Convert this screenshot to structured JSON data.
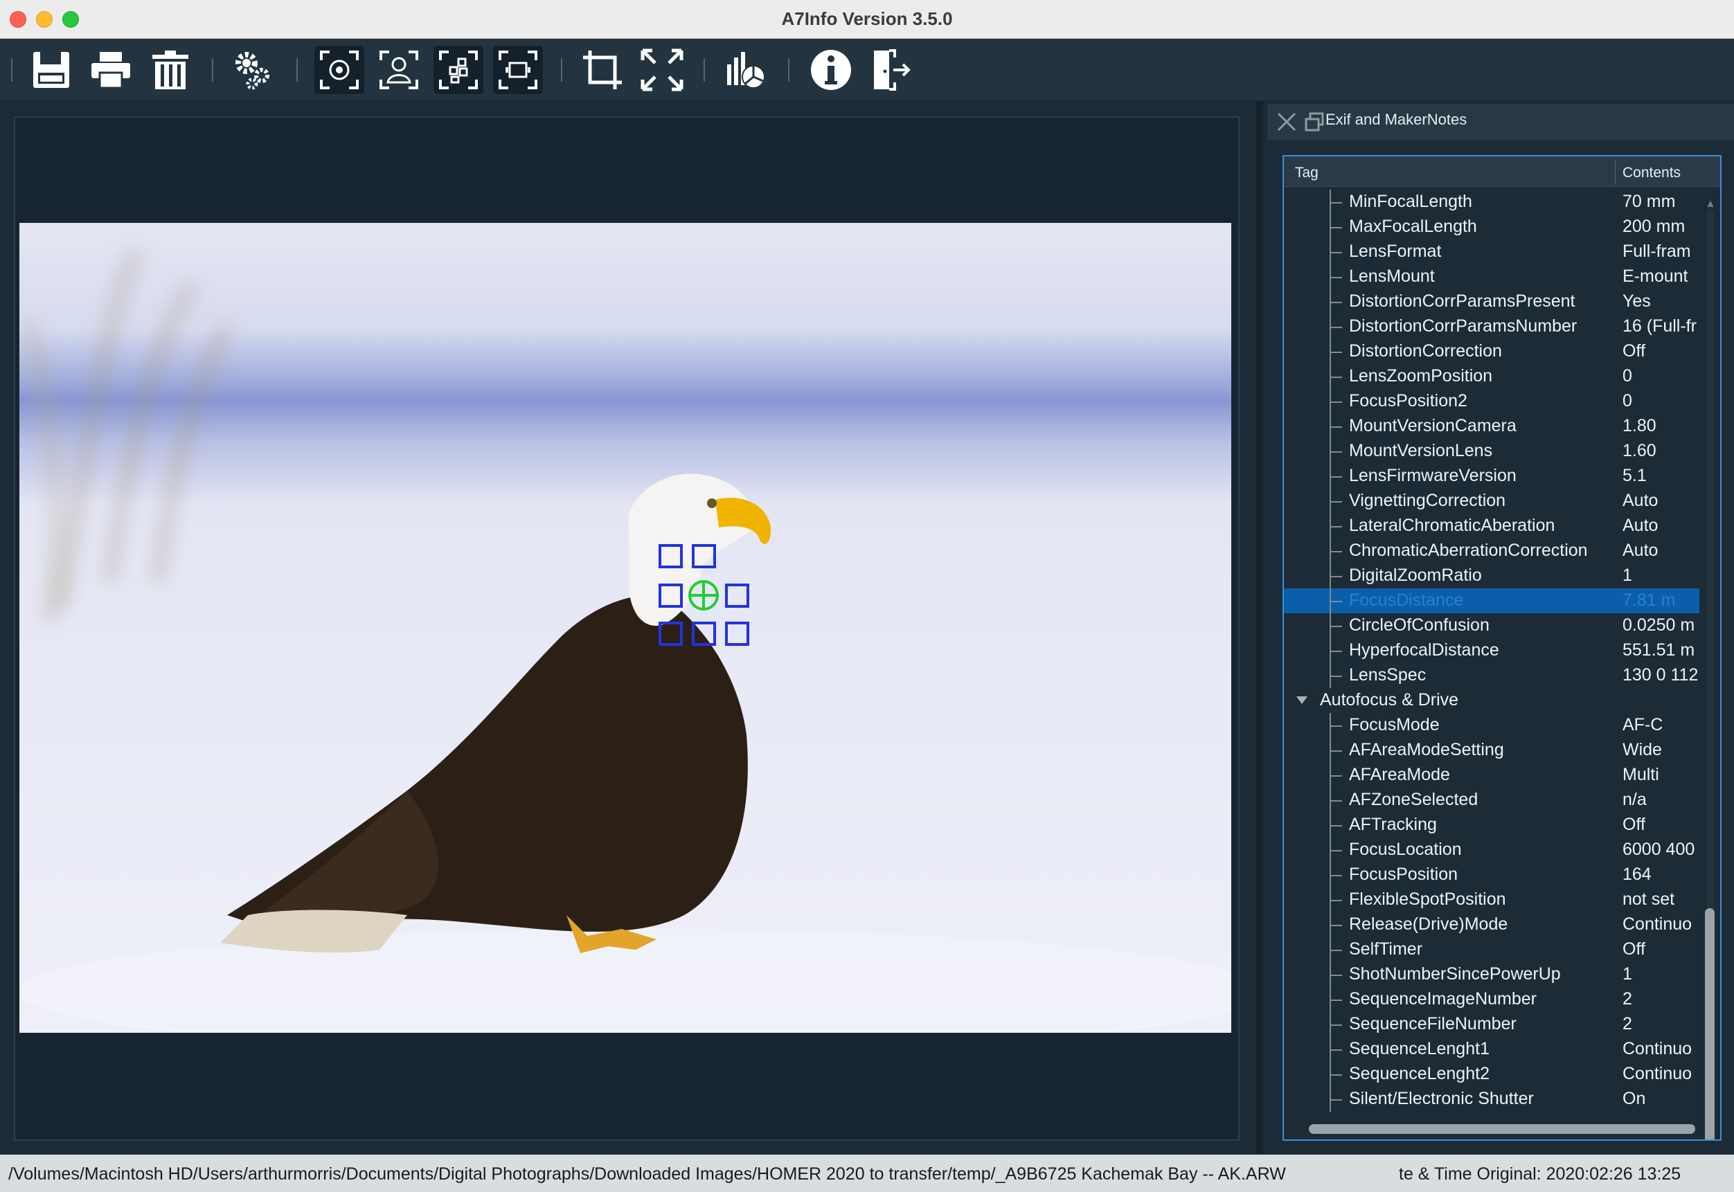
{
  "window": {
    "title": "A7Info Version 3.5.0"
  },
  "toolbar": {
    "buttons": [
      {
        "name": "save-icon",
        "label": "Save"
      },
      {
        "name": "print-icon",
        "label": "Print"
      },
      {
        "name": "trash-icon",
        "label": "Delete"
      },
      {
        "name": "settings-gears-icon",
        "label": "Settings"
      },
      {
        "name": "focus-point-icon",
        "label": "Focus point",
        "active": true
      },
      {
        "name": "face-detect-icon",
        "label": "Face detection"
      },
      {
        "name": "af-area-icon",
        "label": "AF area",
        "active": true
      },
      {
        "name": "frame-icon",
        "label": "Frame",
        "active": true
      },
      {
        "name": "crop-icon",
        "label": "Crop"
      },
      {
        "name": "fullscreen-icon",
        "label": "Fullscreen"
      },
      {
        "name": "chart-icon",
        "label": "Statistics"
      },
      {
        "name": "info-icon",
        "label": "Info"
      },
      {
        "name": "exit-icon",
        "label": "Exit"
      }
    ]
  },
  "dock": {
    "title": "Exif and MakerNotes",
    "columns": {
      "tag": "Tag",
      "contents": "Contents"
    },
    "rows": [
      {
        "tag": "MinFocalLength",
        "value": "70 mm"
      },
      {
        "tag": "MaxFocalLength",
        "value": "200 mm"
      },
      {
        "tag": "LensFormat",
        "value": "Full-fram"
      },
      {
        "tag": "LensMount",
        "value": "E-mount"
      },
      {
        "tag": "DistortionCorrParamsPresent",
        "value": "Yes"
      },
      {
        "tag": "DistortionCorrParamsNumber",
        "value": "16 (Full-fr"
      },
      {
        "tag": "DistortionCorrection",
        "value": "Off"
      },
      {
        "tag": "LensZoomPosition",
        "value": "0"
      },
      {
        "tag": "FocusPosition2",
        "value": "0"
      },
      {
        "tag": "MountVersionCamera",
        "value": "1.80"
      },
      {
        "tag": "MountVersionLens",
        "value": "1.60"
      },
      {
        "tag": "LensFirmwareVersion",
        "value": "5.1"
      },
      {
        "tag": "VignettingCorrection",
        "value": "Auto"
      },
      {
        "tag": "LateralChromaticAberation",
        "value": "Auto"
      },
      {
        "tag": "ChromaticAberrationCorrection",
        "value": "Auto"
      },
      {
        "tag": "DigitalZoomRatio",
        "value": "1"
      },
      {
        "tag": "FocusDistance",
        "value": "7.81 m",
        "selected": true
      },
      {
        "tag": "CircleOfConfusion",
        "value": "0.0250 m"
      },
      {
        "tag": "HyperfocalDistance",
        "value": "551.51 m"
      },
      {
        "tag": "LensSpec",
        "value": "130 0 112"
      },
      {
        "tag": "Autofocus & Drive",
        "value": "",
        "group": true
      },
      {
        "tag": "FocusMode",
        "value": "AF-C"
      },
      {
        "tag": "AFAreaModeSetting",
        "value": "Wide"
      },
      {
        "tag": "AFAreaMode",
        "value": "Multi"
      },
      {
        "tag": "AFZoneSelected",
        "value": "n/a"
      },
      {
        "tag": "AFTracking",
        "value": "Off"
      },
      {
        "tag": "FocusLocation",
        "value": "6000 400"
      },
      {
        "tag": "FocusPosition",
        "value": "164"
      },
      {
        "tag": "FlexibleSpotPosition",
        "value": "not set"
      },
      {
        "tag": "Release(Drive)Mode",
        "value": "Continuo"
      },
      {
        "tag": "SelfTimer",
        "value": "Off"
      },
      {
        "tag": "ShotNumberSincePowerUp",
        "value": "1"
      },
      {
        "tag": "SequenceImageNumber",
        "value": "2"
      },
      {
        "tag": "SequenceFileNumber",
        "value": "2"
      },
      {
        "tag": "SequenceLenght1",
        "value": "Continuo"
      },
      {
        "tag": "SequenceLenght2",
        "value": "Continuo"
      },
      {
        "tag": "Silent/Electronic Shutter",
        "value": "On"
      }
    ]
  },
  "status": {
    "path": "/Volumes/Macintosh HD/Users/arthurmorris/Documents/Digital Photographs/Downloaded Images/HOMER 2020 to transfer/temp/_A9B6725 Kachemak Bay -- AK.ARW",
    "date": "te & Time Original: 2020:02:26 13:25"
  },
  "colors": {
    "background": "#1c2b36",
    "selection": "#0a5fa8",
    "focus_box": "#2233dd",
    "focus_point": "#22cc33",
    "tree_border": "#3b8fe0"
  }
}
